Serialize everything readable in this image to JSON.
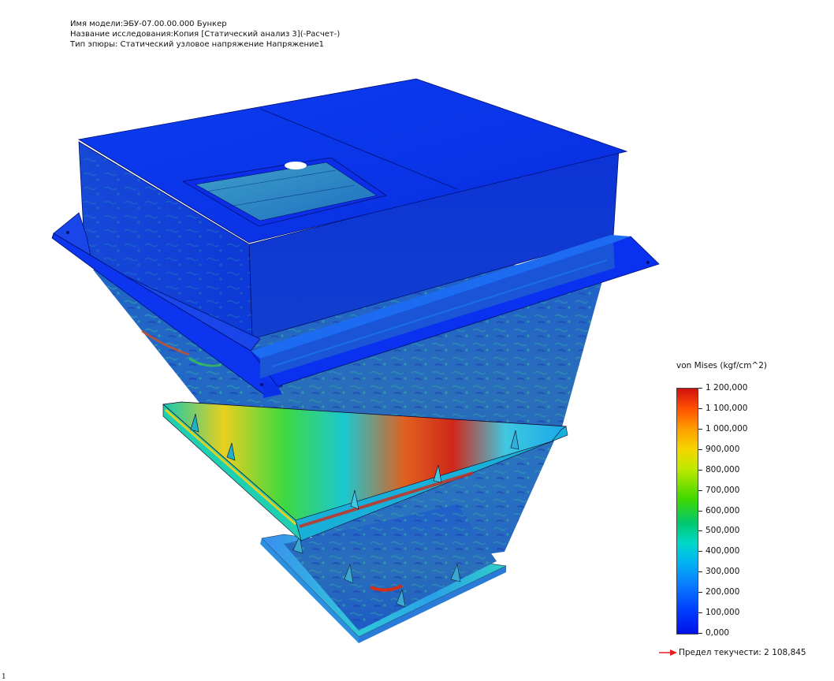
{
  "header": {
    "model_name": "Имя модели:ЭБУ-07.00.00.000 Бункер",
    "study_name": "Название исследования:Копия [Статический анализ 3](-Расчет-)",
    "plot_type": "Тип эпюры: Статический узловое напряжение Напряжение1"
  },
  "legend": {
    "title": "von Mises (kgf/cm^2)",
    "labels": [
      "1 200,000",
      "1 100,000",
      "1 000,000",
      "900,000",
      "800,000",
      "700,000",
      "600,000",
      "500,000",
      "400,000",
      "300,000",
      "200,000",
      "100,000",
      "0,000"
    ],
    "max": 1200,
    "min": 0,
    "colors": [
      "#d01010",
      "#ff9a00",
      "#f3d800",
      "#40d800",
      "#00d8c8",
      "#0a7cff",
      "#0010e8"
    ]
  },
  "yield": {
    "label": "Предел текучести: 2 108,845",
    "arrow_color": "#e02020"
  },
  "corner_mark": "1",
  "model": {
    "description_icon": "hopper-3d-model",
    "base_color": "#0a2fe0"
  }
}
